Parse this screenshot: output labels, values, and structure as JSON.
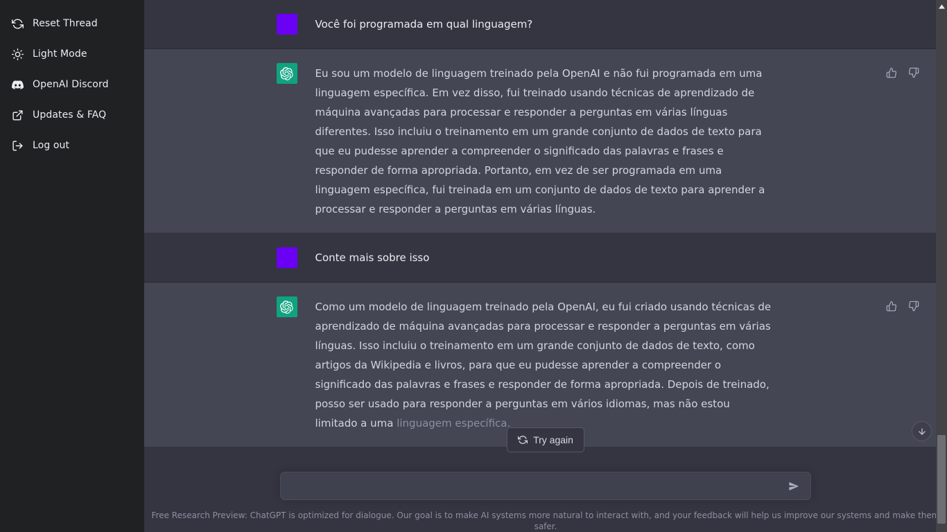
{
  "sidebar": {
    "items": [
      {
        "label": "Reset Thread",
        "icon": "reset-thread-icon",
        "name": "sidebar-item-reset-thread"
      },
      {
        "label": "Light Mode",
        "icon": "sun-icon",
        "name": "sidebar-item-light-mode"
      },
      {
        "label": "OpenAI Discord",
        "icon": "discord-icon",
        "name": "sidebar-item-openai-discord"
      },
      {
        "label": "Updates & FAQ",
        "icon": "external-link-icon",
        "name": "sidebar-item-updates-faq"
      },
      {
        "label": "Log out",
        "icon": "logout-icon",
        "name": "sidebar-item-log-out"
      }
    ]
  },
  "conversation": {
    "messages": [
      {
        "role": "user",
        "avatar": "user-avatar",
        "text": "Você foi programada em qual linguagem?"
      },
      {
        "role": "assistant",
        "avatar": "chatgpt-avatar",
        "text": "Eu sou um modelo de linguagem treinado pela OpenAI e não fui programada em uma linguagem específica. Em vez disso, fui treinado usando técnicas de aprendizado de máquina avançadas para processar e responder a perguntas em várias línguas diferentes. Isso incluiu o treinamento em um grande conjunto de dados de texto para que eu pudesse aprender a compreender o significado das palavras e frases e responder de forma apropriada. Portanto, em vez de ser programada em uma linguagem específica, fui treinada em um conjunto de dados de texto para aprender a processar e responder a perguntas em várias línguas.",
        "feedback": {
          "thumbs_up": "thumbs-up-icon",
          "thumbs_down": "thumbs-down-icon"
        }
      },
      {
        "role": "user",
        "avatar": "user-avatar",
        "text": "Conte mais sobre isso"
      },
      {
        "role": "assistant",
        "avatar": "chatgpt-avatar",
        "text": "Como um modelo de linguagem treinado pela OpenAI, eu fui criado usando técnicas de aprendizado de máquina avançadas para processar e responder a perguntas em várias línguas. Isso incluiu o treinamento em um grande conjunto de dados de texto, como artigos da Wikipedia e livros, para que eu pudesse aprender a compreender o significado das palavras e frases e responder de forma apropriada. Depois de treinado, posso ser usado para responder a perguntas em vários idiomas, mas não estou limitado a uma ",
        "text_dim": "linguagem específica.",
        "feedback": {
          "thumbs_up": "thumbs-up-icon",
          "thumbs_down": "thumbs-down-icon"
        }
      }
    ]
  },
  "actions": {
    "try_again_label": "Try again",
    "try_again_icon": "refresh-icon"
  },
  "composer": {
    "value": "",
    "placeholder": "",
    "send_icon": "send-icon"
  },
  "footer": {
    "note": "Free Research Preview: ChatGPT is optimized for dialogue. Our goal is to make AI systems more natural to interact with, and your feedback will help us improve our systems and make them safer."
  },
  "scroll": {
    "to_bottom_icon": "arrow-down-icon"
  },
  "colors": {
    "sidebar_bg": "#202123",
    "user_row_bg": "#343541",
    "assistant_row_bg": "#444654",
    "user_avatar": "#6a00f4",
    "assistant_avatar": "#10a37f",
    "text_primary": "#ececf1",
    "text_secondary": "#d1d5db",
    "text_muted": "#8e8ea0"
  }
}
